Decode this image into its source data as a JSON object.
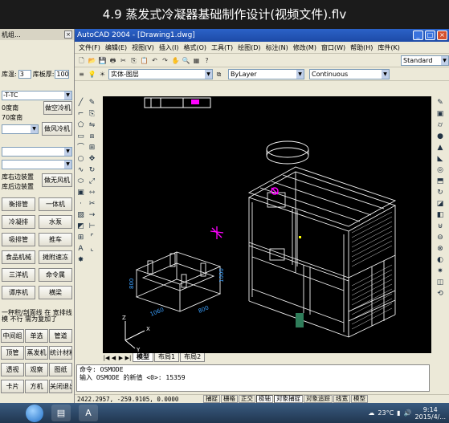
{
  "video": {
    "title": "4.9 蒸发式冷凝器基础制作设计(视频文件).flv"
  },
  "left_panel": {
    "title": "机组...",
    "close": "×",
    "ku_label": "库温:",
    "ku_value": "3",
    "ban_label": "库板厚:",
    "ban_value": "100",
    "combo1": "-T-TC",
    "text1": "0度南",
    "text2": "70度南",
    "btn_cold_machine": "做空冷机",
    "btn_air_cooler": "做风冷机",
    "text3": "库右边装置",
    "text4": "库后边装置",
    "btn_do_fan": "做无风机",
    "grid": [
      "衡排管",
      "一体机",
      "冷凝排",
      "水泵",
      "吸排管",
      "推车",
      "食品机械",
      "摊附速冻",
      "三洋机",
      "命令属",
      "谭序机",
      "横梁"
    ],
    "bottom_text": [
      "中间组",
      "单选",
      "管道",
      "顶管",
      "蒸发机",
      "统计材料",
      "透视",
      "观察",
      "图纸",
      "卡片",
      "方机",
      "关闭退出"
    ],
    "note": "一秤积/剖面线 在 宽排线模 不行 需为复加了"
  },
  "acad": {
    "title": "AutoCAD 2004 - [Drawing1.dwg]",
    "menu": [
      "文件(F)",
      "编辑(E)",
      "视图(V)",
      "插入(I)",
      "格式(O)",
      "工具(T)",
      "绘图(D)",
      "标注(N)",
      "修改(M)",
      "窗口(W)",
      "帮助(H)",
      "库件(K)"
    ],
    "style_combo": "Standard",
    "layer_combo": "实体-图层",
    "bylayer": "ByLayer",
    "linetype": "Continuous",
    "tabs": [
      "模型",
      "布局1",
      "布局2"
    ],
    "command_lines": [
      "命令: OSMODE",
      "输入 OSMODE 的新值 <0>: 15359"
    ],
    "coords": "2422.2957, -259.9105, 0.0000",
    "status_buttons": [
      "捕捉",
      "栅格",
      "正交",
      "极轴",
      "对象捕捉",
      "对象追踪",
      "线宽",
      "模型"
    ],
    "dims": {
      "d1": "1060",
      "d2": "800",
      "d3": "1000",
      "d4": "800"
    }
  },
  "taskbar": {
    "time": "9:14",
    "date": "2015/4/...",
    "temp": "23°C"
  }
}
